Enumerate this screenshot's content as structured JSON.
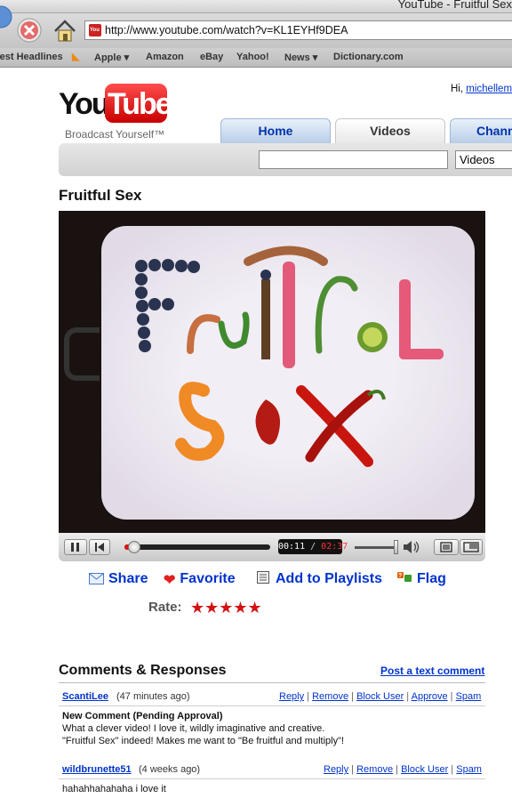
{
  "window": {
    "title": "YouTube - Fruitful Sex"
  },
  "browser": {
    "url": "http://www.youtube.com/watch?v=KL1EYHf9DEA",
    "bookmarks": [
      "test Headlines",
      "Apple ▾",
      "Amazon",
      "eBay",
      "Yahoo!",
      "News ▾",
      "Dictionary.com"
    ]
  },
  "header": {
    "logo_you": "You",
    "logo_tube": "Tube",
    "tagline": "Broadcast Yourself™",
    "greeting": "Hi,",
    "username": "michellem",
    "tabs": [
      "Home",
      "Videos",
      "Chann"
    ],
    "search_scope": "Videos"
  },
  "video": {
    "title": "Fruitful Sex",
    "current_time": "00:11",
    "time_sep": " / ",
    "total_time": "02:37",
    "progress": 0.07
  },
  "actions": {
    "share": "Share",
    "favorite": "Favorite",
    "add_to_playlists": "Add to Playlists",
    "flag": "Flag",
    "rate_label": "Rate:",
    "rating_stars": "★★★★★"
  },
  "comments": {
    "heading": "Comments & Responses",
    "post_link": "Post a text comment",
    "link_labels": {
      "reply": "Reply",
      "remove": "Remove",
      "block": "Block User",
      "approve": "Approve",
      "spam": "Spam",
      "sep": " | "
    },
    "items": [
      {
        "author": "ScantiLee",
        "time": "(47 minutes ago)",
        "status": "New Comment (Pending Approval)",
        "lines": [
          "What a clever video! I love it, wildly imaginative and creative.",
          "\"Fruitful Sex\" indeed! Makes me want to \"Be fruitful and multiply\"!"
        ]
      },
      {
        "author": "wildbrunette51",
        "time": "(4 weeks ago)",
        "lines": [
          "hahahhahahaha i love it"
        ]
      }
    ]
  },
  "colors": {
    "link": "#0033cc",
    "youtube_red": "#cc0000",
    "star": "#d21212"
  }
}
